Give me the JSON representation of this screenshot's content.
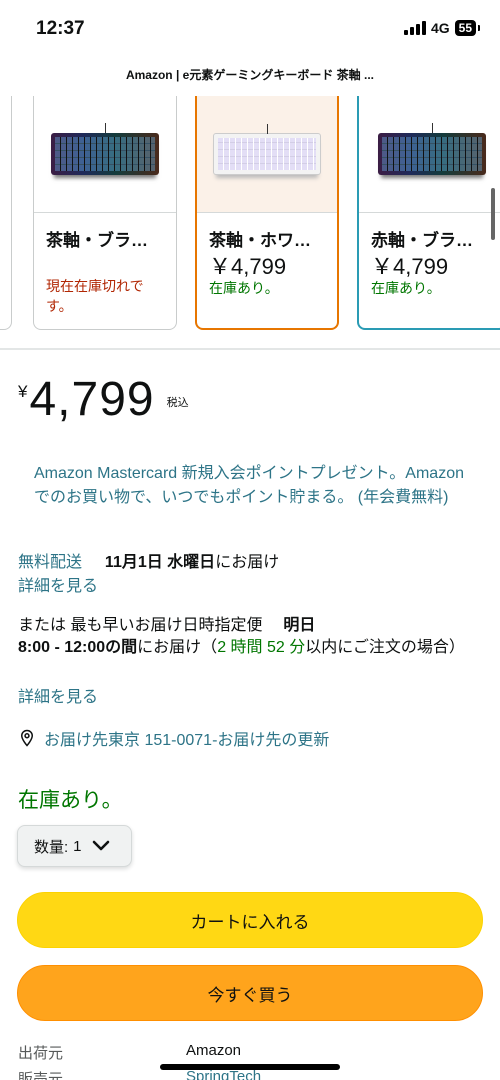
{
  "status_bar": {
    "time": "12:37",
    "network": "4G",
    "battery": "55"
  },
  "page": {
    "title": "Amazon | e元素ゲーミングキーボード 茶軸 ..."
  },
  "variants": [
    {
      "name": "茶軸・ブラ…",
      "price": "",
      "availability": "現在在庫切れです。",
      "state": "out"
    },
    {
      "name": "茶軸・ホワ…",
      "price": "￥4,799",
      "availability": "在庫あり。",
      "state": "selected"
    },
    {
      "name": "赤軸・ブラ…",
      "price": "￥4,799",
      "availability": "在庫あり。",
      "state": "in"
    }
  ],
  "price": {
    "symbol": "¥",
    "amount": "4,799",
    "tax_note": "税込"
  },
  "card_offer": "Amazon Mastercard 新規入会ポイントプレゼント。Amazonでのお買い物で、いつでもポイント貯まる。 (年会費無料)",
  "delivery": {
    "free_label": "無料配送",
    "date": "11月1日 水曜日",
    "date_suffix": "にお届け",
    "details_link": "詳細を見る",
    "fastest_prefix": "または 最も早いお届け日時指定便",
    "fastest_day": "明日",
    "fastest_window": "8:00 - 12:00の間",
    "fastest_suffix": "にお届け（",
    "countdown": "2 時間 52 分",
    "countdown_suffix": "以内にご注文の場合）",
    "details_link_2": "詳細を見る"
  },
  "address": "お届け先東京 151-0071-お届け先の更新",
  "stock_status": "在庫あり。",
  "quantity": {
    "label": "数量:",
    "value": "1"
  },
  "buttons": {
    "add_to_cart": "カートに入れる",
    "buy_now": "今すぐ買う"
  },
  "seller_info": {
    "ships_from_label": "出荷元",
    "ships_from_value": "Amazon",
    "sold_by_label": "販売元",
    "sold_by_value": "SpringTech"
  }
}
